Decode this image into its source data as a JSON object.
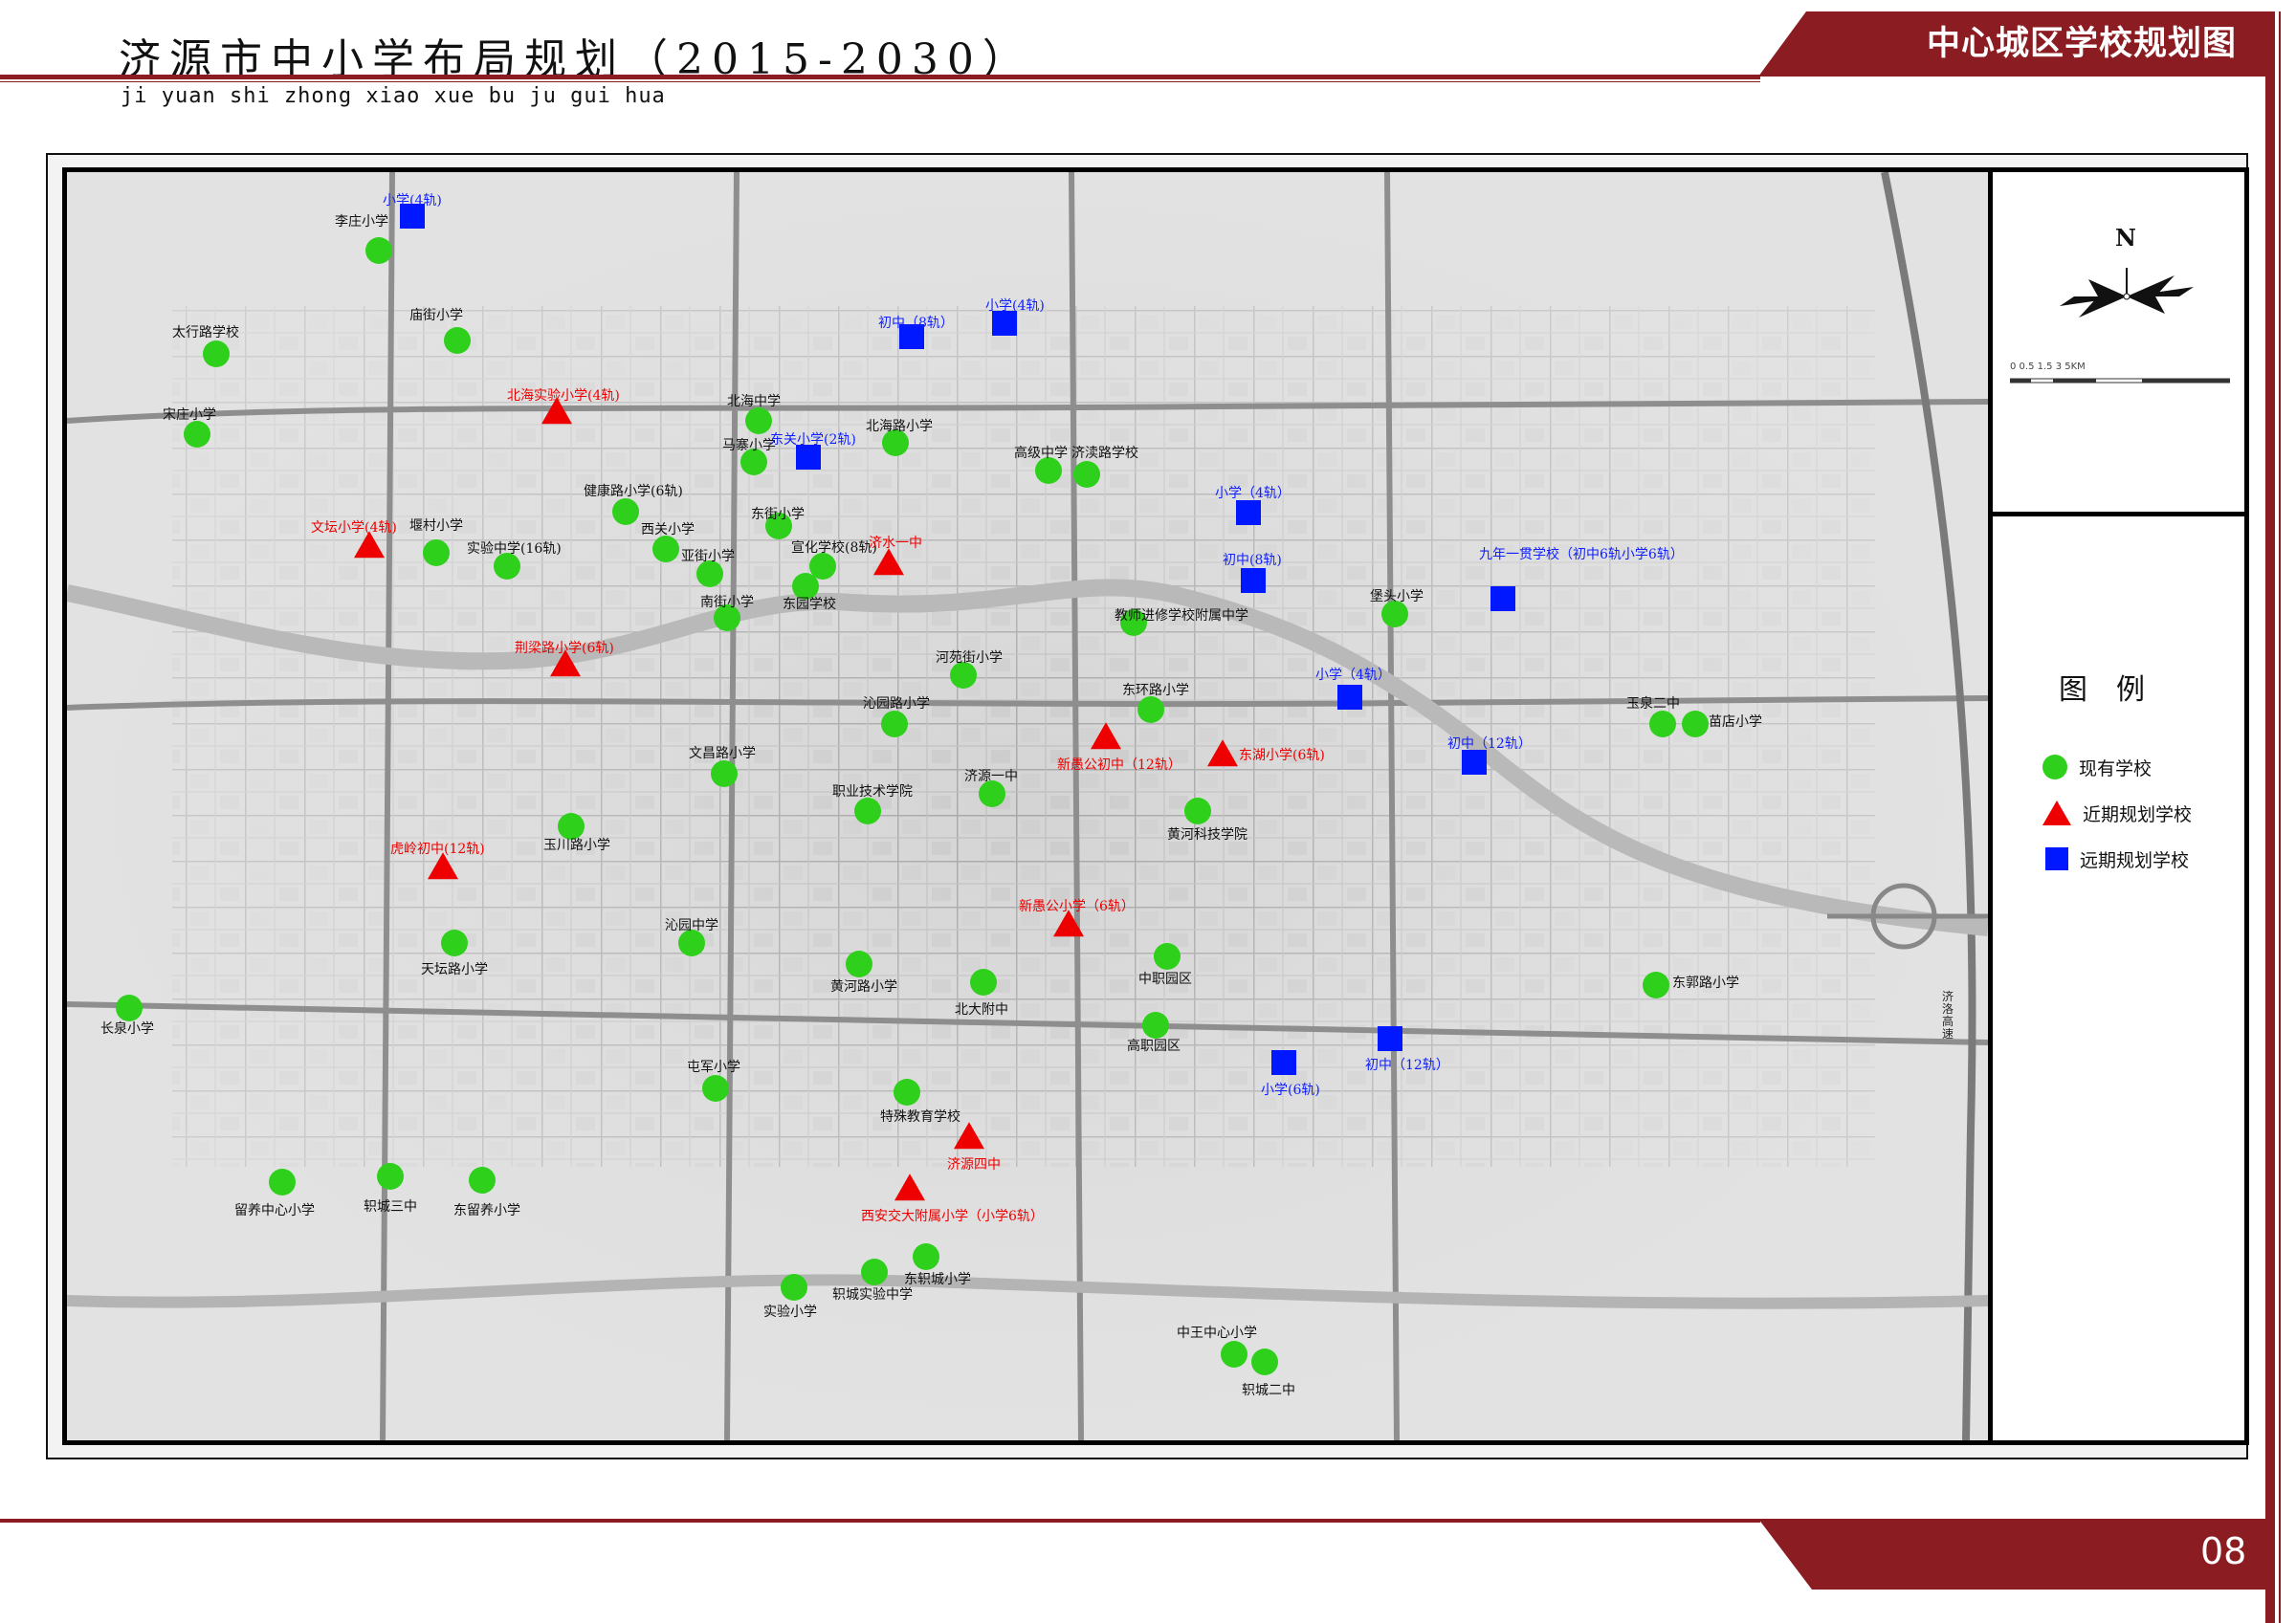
{
  "header": {
    "title": "济源市中小学布局规划（2015-2030）",
    "pinyin": "ji yuan shi zhong xiao xue bu ju gui hua",
    "section_title": "中心城区学校规划图"
  },
  "footer": {
    "page_number": "08"
  },
  "compass": {
    "north_label": "N",
    "scale_text": "0   0.5    1.5      3          5KM"
  },
  "legend": {
    "title": "图例",
    "items": [
      {
        "label": "现有学校",
        "symbol": "green-circle"
      },
      {
        "label": "近期规划学校",
        "symbol": "red-triangle"
      },
      {
        "label": "远期规划学校",
        "symbol": "blue-square"
      }
    ]
  },
  "map": {
    "road_label": "济洛高速",
    "colors": {
      "existing": "#2ed01c",
      "near_term": "#ee0000",
      "long_term": "#0018ff",
      "brand": "#8b1c22"
    },
    "schools": [
      {
        "name": "李庄小学",
        "type": "existing"
      },
      {
        "name": "庙街小学",
        "type": "existing"
      },
      {
        "name": "太行路学校",
        "type": "existing"
      },
      {
        "name": "宋庄小学",
        "type": "existing"
      },
      {
        "name": "北海中学",
        "type": "existing"
      },
      {
        "name": "马寨小学",
        "type": "existing"
      },
      {
        "name": "北海路小学",
        "type": "existing"
      },
      {
        "name": "高级中学",
        "type": "existing"
      },
      {
        "name": "济渎路学校",
        "type": "existing"
      },
      {
        "name": "健康路小学(6轨)",
        "type": "existing"
      },
      {
        "name": "东街小学",
        "type": "existing"
      },
      {
        "name": "西关小学",
        "type": "existing"
      },
      {
        "name": "堰村小学",
        "type": "existing"
      },
      {
        "name": "实验中学(16轨)",
        "type": "existing"
      },
      {
        "name": "亚街小学",
        "type": "existing"
      },
      {
        "name": "宣化学校(8轨)",
        "type": "existing"
      },
      {
        "name": "东园学校",
        "type": "existing"
      },
      {
        "name": "南街小学",
        "type": "existing"
      },
      {
        "name": "教师进修学校附属中学",
        "type": "existing"
      },
      {
        "name": "堡头小学",
        "type": "existing"
      },
      {
        "name": "河苑街小学",
        "type": "existing"
      },
      {
        "name": "东环路小学",
        "type": "existing"
      },
      {
        "name": "沁园路小学",
        "type": "existing"
      },
      {
        "name": "文昌路小学",
        "type": "existing"
      },
      {
        "name": "职业技术学院",
        "type": "existing"
      },
      {
        "name": "济源一中",
        "type": "existing"
      },
      {
        "name": "黄河科技学院",
        "type": "existing"
      },
      {
        "name": "玉泉二中",
        "type": "existing"
      },
      {
        "name": "苗店小学",
        "type": "existing"
      },
      {
        "name": "玉川路小学",
        "type": "existing"
      },
      {
        "name": "天坛路小学",
        "type": "existing"
      },
      {
        "name": "沁园中学",
        "type": "existing"
      },
      {
        "name": "黄河路小学",
        "type": "existing"
      },
      {
        "name": "北大附中",
        "type": "existing"
      },
      {
        "name": "中职园区",
        "type": "existing"
      },
      {
        "name": "高职园区",
        "type": "existing"
      },
      {
        "name": "东郭路小学",
        "type": "existing"
      },
      {
        "name": "长泉小学",
        "type": "existing"
      },
      {
        "name": "屯军小学",
        "type": "existing"
      },
      {
        "name": "特殊教育学校",
        "type": "existing"
      },
      {
        "name": "留养中心小学",
        "type": "existing"
      },
      {
        "name": "轵城三中",
        "type": "existing"
      },
      {
        "name": "东留养小学",
        "type": "existing"
      },
      {
        "name": "轵城实验中学",
        "type": "existing"
      },
      {
        "name": "东轵城小学",
        "type": "existing"
      },
      {
        "name": "实验小学",
        "type": "existing"
      },
      {
        "name": "中王中心小学",
        "type": "existing"
      },
      {
        "name": "轵城二中",
        "type": "existing"
      },
      {
        "name": "北海实验小学(4轨)",
        "type": "near"
      },
      {
        "name": "文坛小学(4轨)",
        "type": "near"
      },
      {
        "name": "济水一中",
        "type": "near"
      },
      {
        "name": "荆梁路小学(6轨)",
        "type": "near"
      },
      {
        "name": "新愚公初中（12轨）",
        "type": "near"
      },
      {
        "name": "东湖小学(6轨)",
        "type": "near"
      },
      {
        "name": "虎岭初中(12轨)",
        "type": "near"
      },
      {
        "name": "新愚公小学（6轨）",
        "type": "near"
      },
      {
        "name": "济源四中",
        "type": "near"
      },
      {
        "name": "西安交大附属小学（小学6轨）",
        "type": "near"
      },
      {
        "name": "小学(4轨)",
        "type": "far"
      },
      {
        "name": "初中（8轨）",
        "type": "far"
      },
      {
        "name": "小学(4轨)",
        "type": "far"
      },
      {
        "name": "东关小学(2轨)",
        "type": "far"
      },
      {
        "name": "小学（4轨）",
        "type": "far"
      },
      {
        "name": "初中(8轨)",
        "type": "far"
      },
      {
        "name": "九年一贯学校（初中6轨小学6轨）",
        "type": "far"
      },
      {
        "name": "小学（4轨）",
        "type": "far"
      },
      {
        "name": "初中（12轨）",
        "type": "far"
      },
      {
        "name": "初中（12轨）",
        "type": "far"
      },
      {
        "name": "小学(6轨)",
        "type": "far"
      }
    ]
  }
}
